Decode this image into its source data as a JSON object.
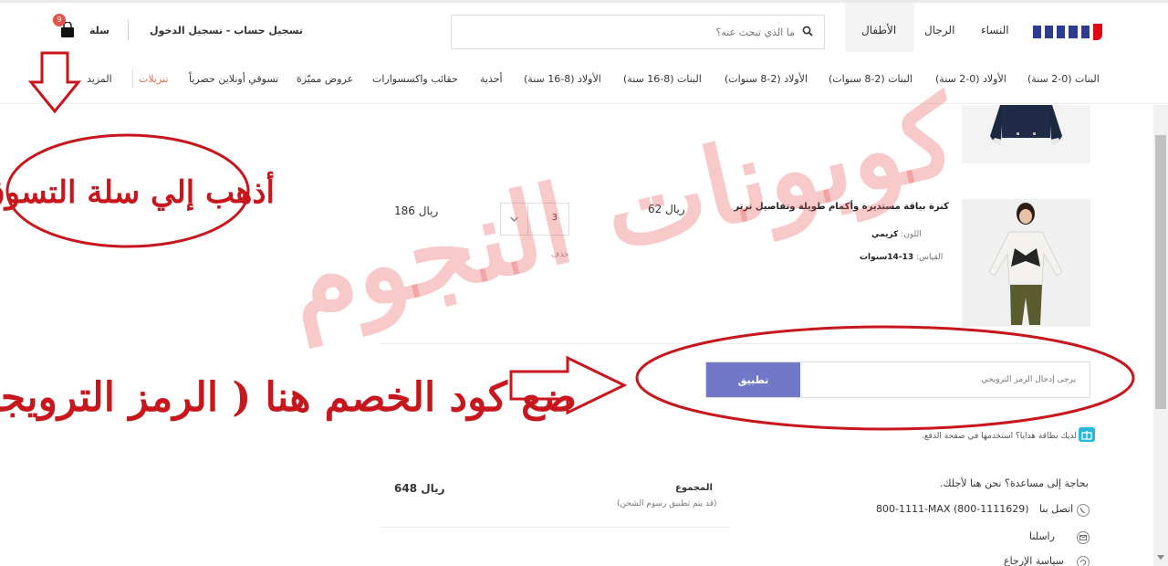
{
  "header": {
    "logo_text": "ماكس",
    "nav": [
      "النساء",
      "الرجال",
      "الأطفال"
    ],
    "search_placeholder": "ما الذي تبحث عنه؟",
    "login_label": "تسجيل حساب - تسجيل الدخول",
    "cart_label": "سلة",
    "cart_count": "9"
  },
  "categories": [
    "البنات (0-2 سنة)",
    "الأولاد (0-2 سنة)",
    "البنات (2-8 سنوات)",
    "الأولاد (2-8 سنوات)",
    "البنات (8-16 سنة)",
    "الأولاد (8-16 سنة)",
    "أحذية",
    "حقائب واكسسوارات",
    "عروض مميّزة",
    "تسوقي أونلاين حصرياً",
    "تنزيلات",
    "المزيد"
  ],
  "product": {
    "name": "كنزة بياقة مستديرة وأكمام طويلة وتفاصيل ترتر",
    "color_label": "اللون:",
    "color_value": "كريمي",
    "size_label": "القياس:",
    "size_value": "13-14سنوات",
    "unit_price": "62",
    "currency": "ريال",
    "quantity": "3",
    "line_total": "186",
    "delete_label": "حذف"
  },
  "promo": {
    "placeholder": "يرجى إدخال الرمز الترويجي",
    "apply_label": "تطبيق"
  },
  "gift_card_text": "لديك بطاقة هدايا؟ استخدمها في صفحة الدفع.",
  "totals": {
    "label": "المجموع",
    "note": "(قد يتم تطبيق رسوم الشحن)",
    "value": "648",
    "currency": "ريال"
  },
  "help": {
    "title": "بحاجة إلى مساعدة؟ نحن هنا لأجلك.",
    "call_label": "اتصل بنا",
    "phone": "800-1111-MAX (800-1111629)",
    "message_label": "راسلنا",
    "returns_label": "سياسة الإرجاع"
  },
  "annotations": {
    "watermark": "كوبونات النجوم",
    "go_to_cart": "أذهب إلي سلة التسوق",
    "put_code": "ضع كود الخصم هنا ( الرمز الترويجي )"
  },
  "colors": {
    "accent": "#7178c8",
    "sale": "#e86e43",
    "badge": "#e6534b",
    "annotation": "#c8161d",
    "logo_blue": "#2d3c8f",
    "logo_red": "#e30613"
  }
}
